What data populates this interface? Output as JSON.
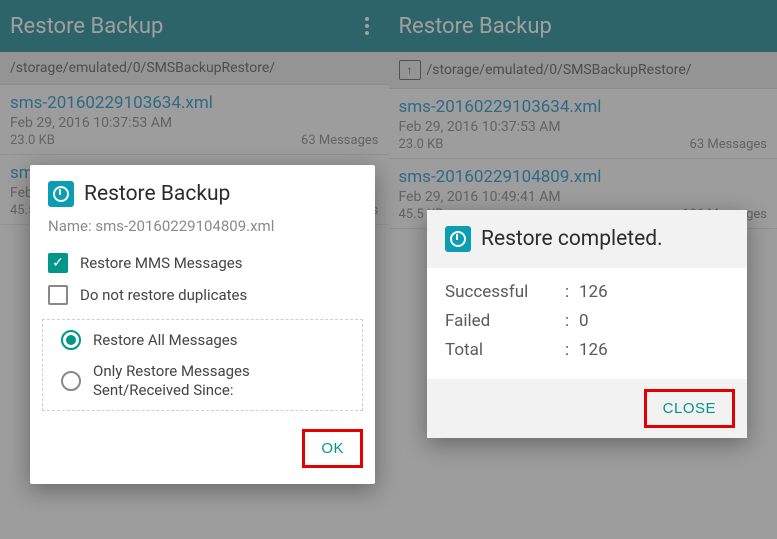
{
  "left": {
    "appbar_title": "Restore Backup",
    "path": "/storage/emulated/0/SMSBackupRestore/",
    "files": [
      {
        "name": "sms-20160229103634.xml",
        "date": "Feb 29, 2016 10:37:53 AM",
        "size": "23.0 KB",
        "count": "63 Messages"
      },
      {
        "name": "sms-20160229104809.xml",
        "date": "Feb 29, 2016 10:49:41 AM",
        "size": "45.5 KB",
        "count": "126 Messages"
      }
    ],
    "dialog": {
      "title": "Restore Backup",
      "name_label": "Name:",
      "name_value": "sms-20160229104809.xml",
      "opt_restore_mms": "Restore MMS Messages",
      "opt_no_duplicates": "Do not restore duplicates",
      "opt_restore_all": "Restore All Messages",
      "opt_restore_since": "Only Restore Messages Sent/Received Since:",
      "ok": "OK"
    }
  },
  "right": {
    "appbar_title": "Restore Backup",
    "path": "/storage/emulated/0/SMSBackupRestore/",
    "files": [
      {
        "name": "sms-20160229103634.xml",
        "date": "Feb 29, 2016 10:37:53 AM",
        "size": "23.0 KB",
        "count": "63 Messages"
      },
      {
        "name": "sms-20160229104809.xml",
        "date": "Feb 29, 2016 10:49:41 AM",
        "size": "45.5 KB",
        "count": "126 Messages"
      }
    ],
    "dialog": {
      "title": "Restore completed.",
      "successful_label": "Successful",
      "successful_value": "126",
      "failed_label": "Failed",
      "failed_value": "0",
      "total_label": "Total",
      "total_value": "126",
      "close": "CLOSE"
    }
  }
}
